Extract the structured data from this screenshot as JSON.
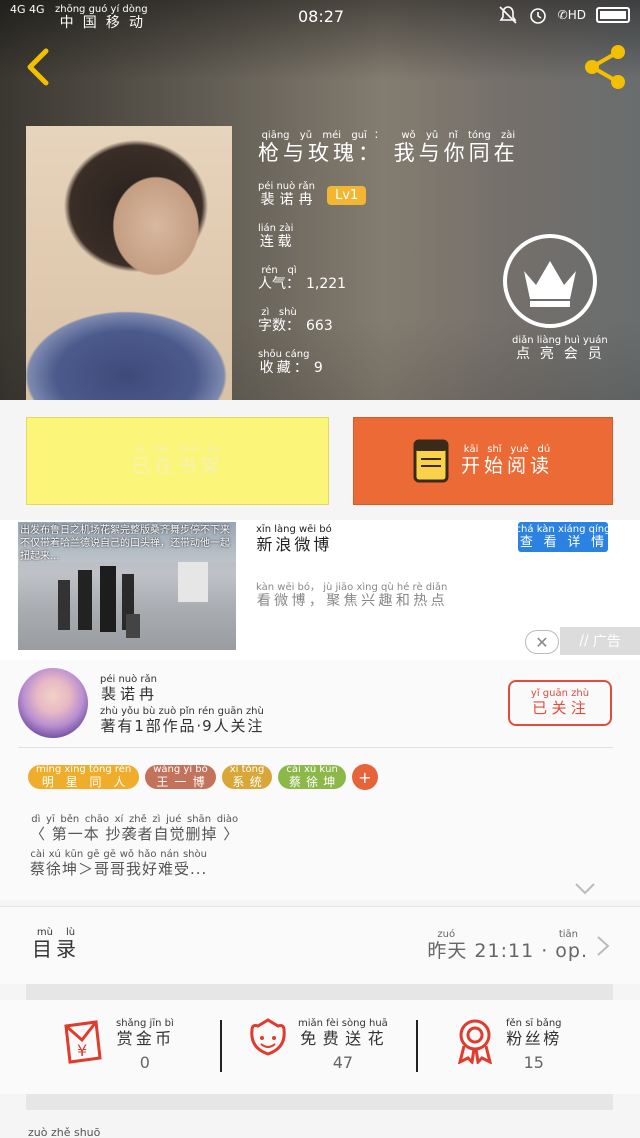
{
  "status_bar": {
    "network": "4G 4G",
    "carrier": "中国移动",
    "carrier_pinyin": "zhōng guó yí dòng",
    "time": "08:27",
    "hd": "HD"
  },
  "book": {
    "title": "枪与玫瑰： 我与你同在",
    "title_pinyin": "qiāng yǔ méi guī： wǒ yǔ nǐ tóng zài",
    "author": "裴诺冉",
    "author_pinyin": "péi nuò rǎn",
    "level": "Lv1",
    "status": "连载",
    "status_pinyin": "lián zài",
    "popularity_label": "人气：",
    "popularity_label_pinyin": "rén qì",
    "popularity": "1,221",
    "word_count_label": "字数：",
    "word_count_label_pinyin": "zì shù",
    "word_count": "663",
    "favorites_label": "收藏：",
    "favorites_label_pinyin": "shōu cáng",
    "favorites": "9"
  },
  "vip": {
    "label": "点亮会员",
    "label_pinyin": "diǎn liàng huì yuán"
  },
  "actions": {
    "add_shelf": "已在书架",
    "add_shelf_pinyin": "yǐ zài shū jià",
    "start_read": "开始阅读",
    "start_read_pinyin": "kāi shǐ yuè dú"
  },
  "ad": {
    "image_caption": "出发布鲁日之机场花絮完整版桑齐舞步停不下来不仅带着哈兰德说自己的口头禅，还带动他一起扭起来...",
    "title": "新浪微博",
    "title_pinyin": "xīn làng wēi bó",
    "subtitle": "看微博，聚焦兴趣和热点",
    "subtitle_pinyin": "kàn wēi bó， jù jiāo xìng qù hé rè diǎn",
    "cta": "查看详情",
    "cta_pinyin": "chá kàn xiáng qíng",
    "close": "✕",
    "tag": "广告"
  },
  "author_section": {
    "name": "裴诺冉",
    "name_pinyin": "péi nuò rǎn",
    "meta": "著有1部作品·9人关注",
    "meta_pinyin": "zhù yǒu bù zuò pǐn rén guān zhù",
    "follow": "已关注",
    "follow_pinyin": "yǐ guān zhù",
    "tags": [
      {
        "label": "明星同人",
        "pinyin": "míng xīng tóng rén",
        "color": "#f0ad2c"
      },
      {
        "label": "王一博",
        "pinyin": "wáng yī bó",
        "color": "#c3735c"
      },
      {
        "label": "系统",
        "pinyin": "xì tǒng",
        "color": "#d9a63a"
      },
      {
        "label": "蔡徐坤",
        "pinyin": "cài xú kūn",
        "color": "#8cb84a"
      }
    ],
    "tag_add": "+",
    "review_line1": "〈 第一本 抄袭者自觉删掉 〉",
    "review_line1_pinyin": "dì yī běn chāo xí zhě zì jué shān diào",
    "review_line2": "蔡徐坤＞哥哥我好难受...",
    "review_line2_pinyin": "cài xú kūn gē gē wǒ hǎo nán shòu"
  },
  "toc": {
    "label": "目录",
    "label_pinyin": "mù lù",
    "update": "昨天 21:11 · op.",
    "update_pinyin": "zuó tiān"
  },
  "stats": [
    {
      "label": "赏金币",
      "pinyin": "shǎng jīn bì",
      "value": "0",
      "icon": "red-packet-icon"
    },
    {
      "label": "免费送花",
      "pinyin": "miǎn fèi sòng huā",
      "value": "47",
      "icon": "flower-icon"
    },
    {
      "label": "粉丝榜",
      "pinyin": "fěn sī bǎng",
      "value": "15",
      "icon": "medal-icon"
    }
  ],
  "bottom_peek": "zuò zhě shuō"
}
